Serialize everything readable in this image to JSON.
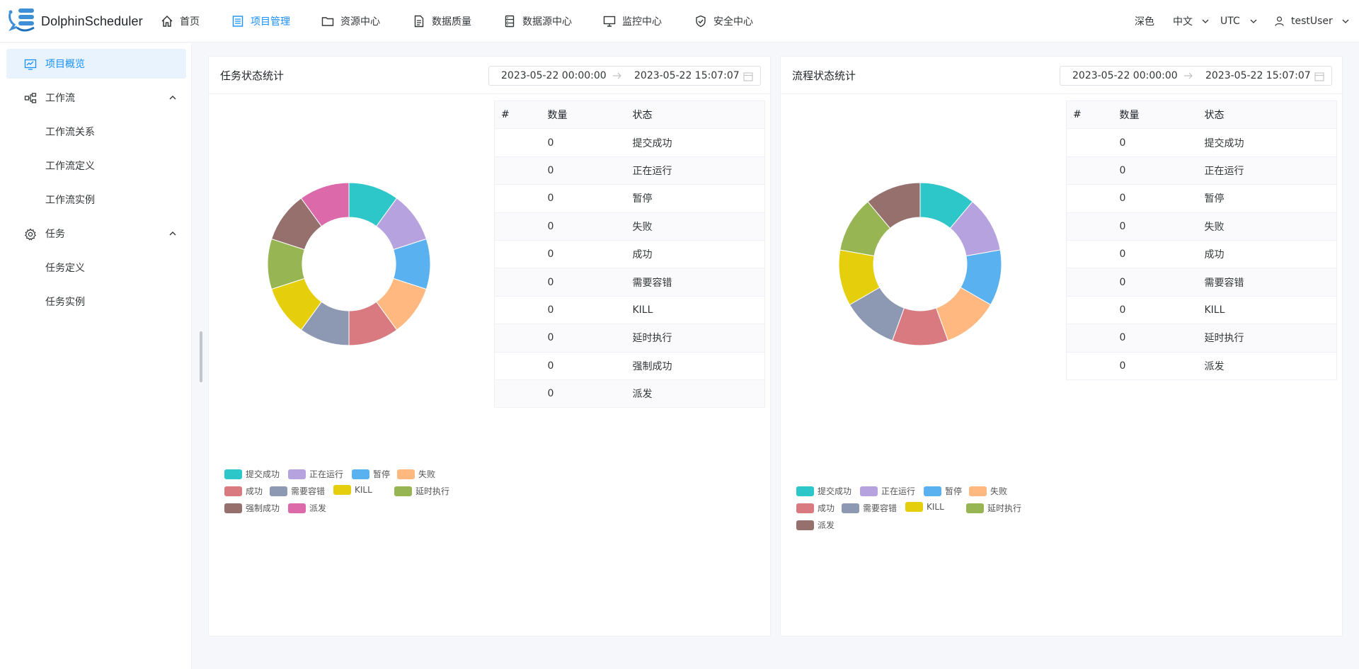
{
  "header": {
    "brand": "DolphinScheduler",
    "nav": [
      {
        "label": "首页",
        "icon": "home-icon"
      },
      {
        "label": "项目管理",
        "icon": "project-icon",
        "active": true
      },
      {
        "label": "资源中心",
        "icon": "folder-icon"
      },
      {
        "label": "数据质量",
        "icon": "document-icon"
      },
      {
        "label": "数据源中心",
        "icon": "database-icon"
      },
      {
        "label": "监控中心",
        "icon": "monitor-icon"
      },
      {
        "label": "安全中心",
        "icon": "shield-icon"
      }
    ],
    "theme_label": "深色",
    "language_label": "中文",
    "timezone_label": "UTC",
    "user_label": "testUser"
  },
  "sidebar": {
    "items": [
      {
        "label": "项目概览",
        "icon": "overview-icon",
        "active": true
      },
      {
        "label": "工作流",
        "icon": "workflow-icon"
      },
      {
        "label": "工作流关系"
      },
      {
        "label": "工作流定义"
      },
      {
        "label": "工作流实例"
      },
      {
        "label": "任务",
        "icon": "gear-icon"
      },
      {
        "label": "任务定义"
      },
      {
        "label": "任务实例"
      }
    ]
  },
  "task_panel": {
    "title": "任务状态统计",
    "start": "2023-05-22 00:00:00",
    "end": "2023-05-22 15:07:07",
    "columns": [
      "#",
      "数量",
      "状态"
    ],
    "rows": [
      {
        "count": "0",
        "state": "提交成功"
      },
      {
        "count": "0",
        "state": "正在运行"
      },
      {
        "count": "0",
        "state": "暂停"
      },
      {
        "count": "0",
        "state": "失败"
      },
      {
        "count": "0",
        "state": "成功"
      },
      {
        "count": "0",
        "state": "需要容错"
      },
      {
        "count": "0",
        "state": "KILL"
      },
      {
        "count": "0",
        "state": "延时执行"
      },
      {
        "count": "0",
        "state": "强制成功"
      },
      {
        "count": "0",
        "state": "派发"
      }
    ]
  },
  "process_panel": {
    "title": "流程状态统计",
    "start": "2023-05-22 00:00:00",
    "end": "2023-05-22 15:07:07",
    "columns": [
      "#",
      "数量",
      "状态"
    ],
    "rows": [
      {
        "count": "0",
        "state": "提交成功"
      },
      {
        "count": "0",
        "state": "正在运行"
      },
      {
        "count": "0",
        "state": "暂停"
      },
      {
        "count": "0",
        "state": "失败"
      },
      {
        "count": "0",
        "state": "成功"
      },
      {
        "count": "0",
        "state": "需要容错"
      },
      {
        "count": "0",
        "state": "KILL"
      },
      {
        "count": "0",
        "state": "延时执行"
      },
      {
        "count": "0",
        "state": "派发"
      }
    ]
  },
  "chart_data": [
    {
      "type": "pie",
      "donut": true,
      "categories": [
        "提交成功",
        "正在运行",
        "暂停",
        "失败",
        "成功",
        "需要容错",
        "KILL",
        "延时执行",
        "强制成功",
        "派发"
      ],
      "values": [
        0,
        0,
        0,
        0,
        0,
        0,
        0,
        0,
        0,
        0
      ],
      "colors": [
        "#2ec7c9",
        "#b6a2de",
        "#5ab1ef",
        "#ffb980",
        "#d87a80",
        "#8d98b3",
        "#e5cf0d",
        "#97b552",
        "#95706d",
        "#dc69aa"
      ],
      "legend": "bottom-left"
    },
    {
      "type": "pie",
      "donut": true,
      "categories": [
        "提交成功",
        "正在运行",
        "暂停",
        "失败",
        "成功",
        "需要容错",
        "KILL",
        "延时执行",
        "派发"
      ],
      "values": [
        0,
        0,
        0,
        0,
        0,
        0,
        0,
        0,
        0
      ],
      "colors": [
        "#2ec7c9",
        "#b6a2de",
        "#5ab1ef",
        "#ffb980",
        "#d87a80",
        "#8d98b3",
        "#e5cf0d",
        "#97b552",
        "#95706d"
      ],
      "legend": "bottom-left"
    }
  ]
}
